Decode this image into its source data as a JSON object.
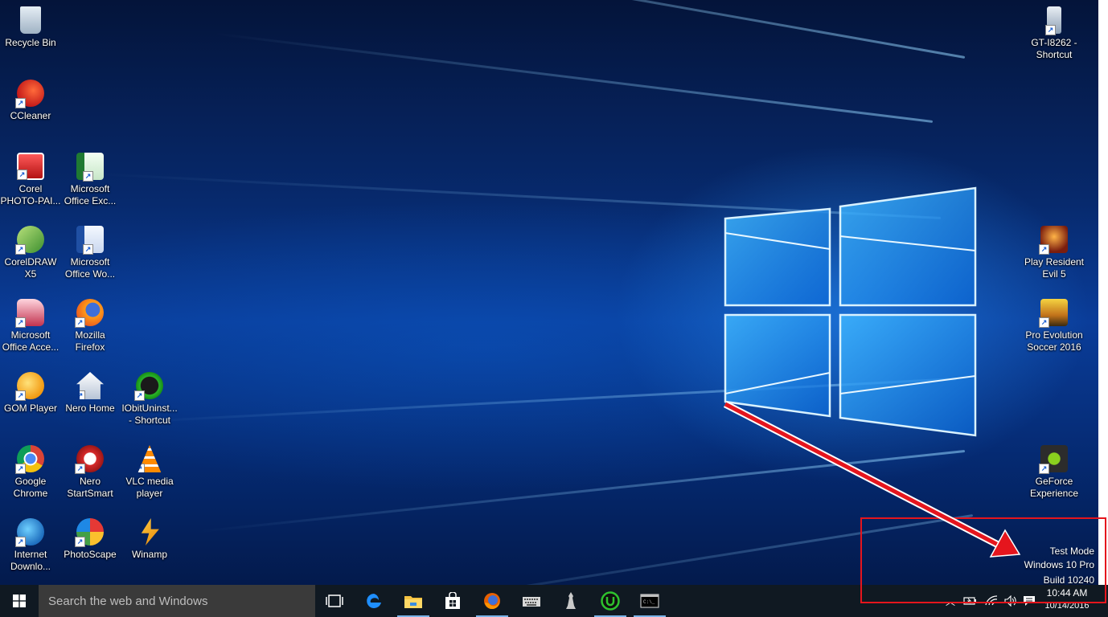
{
  "desktop": {
    "icons_left": [
      {
        "label": "Recycle Bin",
        "icon": "recycle-bin-icon"
      },
      {
        "label": "CCleaner",
        "icon": "ccleaner-icon"
      },
      {
        "label": "Corel\nPHOTO-PAI...",
        "icon": "corel-photo-paint-icon"
      },
      {
        "label": "Microsoft\nOffice Exc...",
        "icon": "excel-icon"
      },
      {
        "label": "CorelDRAW\nX5",
        "icon": "coreldraw-icon"
      },
      {
        "label": "Microsoft\nOffice Wo...",
        "icon": "word-icon"
      },
      {
        "label": "Microsoft\nOffice Acce...",
        "icon": "access-icon"
      },
      {
        "label": "Mozilla\nFirefox",
        "icon": "firefox-icon"
      },
      {
        "label": "GOM Player",
        "icon": "gom-player-icon"
      },
      {
        "label": "Nero Home",
        "icon": "nero-home-icon"
      },
      {
        "label": "IObitUninst...\n- Shortcut",
        "icon": "iobit-uninstaller-icon"
      },
      {
        "label": "Google\nChrome",
        "icon": "chrome-icon"
      },
      {
        "label": "Nero\nStartSmart",
        "icon": "nero-startsmart-icon"
      },
      {
        "label": "VLC media\nplayer",
        "icon": "vlc-icon"
      },
      {
        "label": "Internet\nDownlo...",
        "icon": "internet-download-manager-icon"
      },
      {
        "label": "PhotoScape",
        "icon": "photoscape-icon"
      },
      {
        "label": "Winamp",
        "icon": "winamp-icon"
      }
    ],
    "icons_right": [
      {
        "label": "GT-I8262 -\nShortcut",
        "icon": "phone-icon"
      },
      {
        "label": "Play Resident\nEvil 5",
        "icon": "resident-evil-icon"
      },
      {
        "label": "Pro Evolution\nSoccer 2016",
        "icon": "pes-icon"
      },
      {
        "label": "GeForce\nExperience",
        "icon": "geforce-icon"
      }
    ]
  },
  "watermark": {
    "line1": "Test Mode",
    "line2": "Windows 10 Pro",
    "line3": "Build 10240"
  },
  "taskbar": {
    "search_placeholder": "Search the web and Windows",
    "apps": [
      "task-view-icon",
      "edge-icon",
      "file-explorer-icon",
      "store-icon",
      "firefox-icon",
      "keyboard-icon",
      "chess-icon",
      "iobit-icon",
      "cmd-icon"
    ],
    "time": "10:44 AM",
    "date": "10/14/2016"
  },
  "colors": {
    "highlight": "#e5151d",
    "taskbar": "#101922",
    "search_box": "#3a3a3a",
    "wallpaper": "#0a3d9a"
  }
}
